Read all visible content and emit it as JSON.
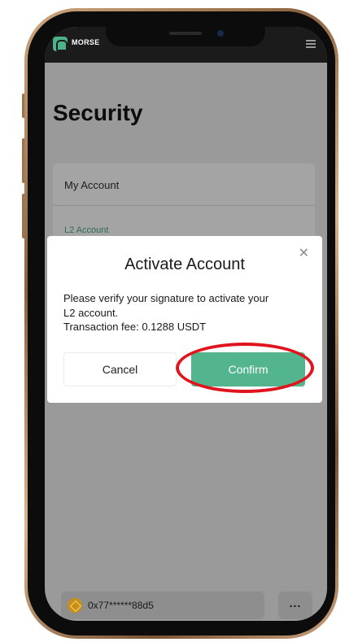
{
  "app": {
    "brand": "MORSE",
    "accent_color": "#52b58e"
  },
  "page": {
    "title": "Security"
  },
  "account_card": {
    "heading": "My Account",
    "l2_label": "L2 Account"
  },
  "modal": {
    "title": "Activate Account",
    "close_icon": "close-icon",
    "body_line1": "Please verify your signature to activate your",
    "body_line2": "L2 account.",
    "body_line3": "Transaction fee: 0.1288 USDT",
    "cancel_label": "Cancel",
    "confirm_label": "Confirm"
  },
  "footer": {
    "wallet_address": "0x77******88d5",
    "more_label": "..."
  }
}
